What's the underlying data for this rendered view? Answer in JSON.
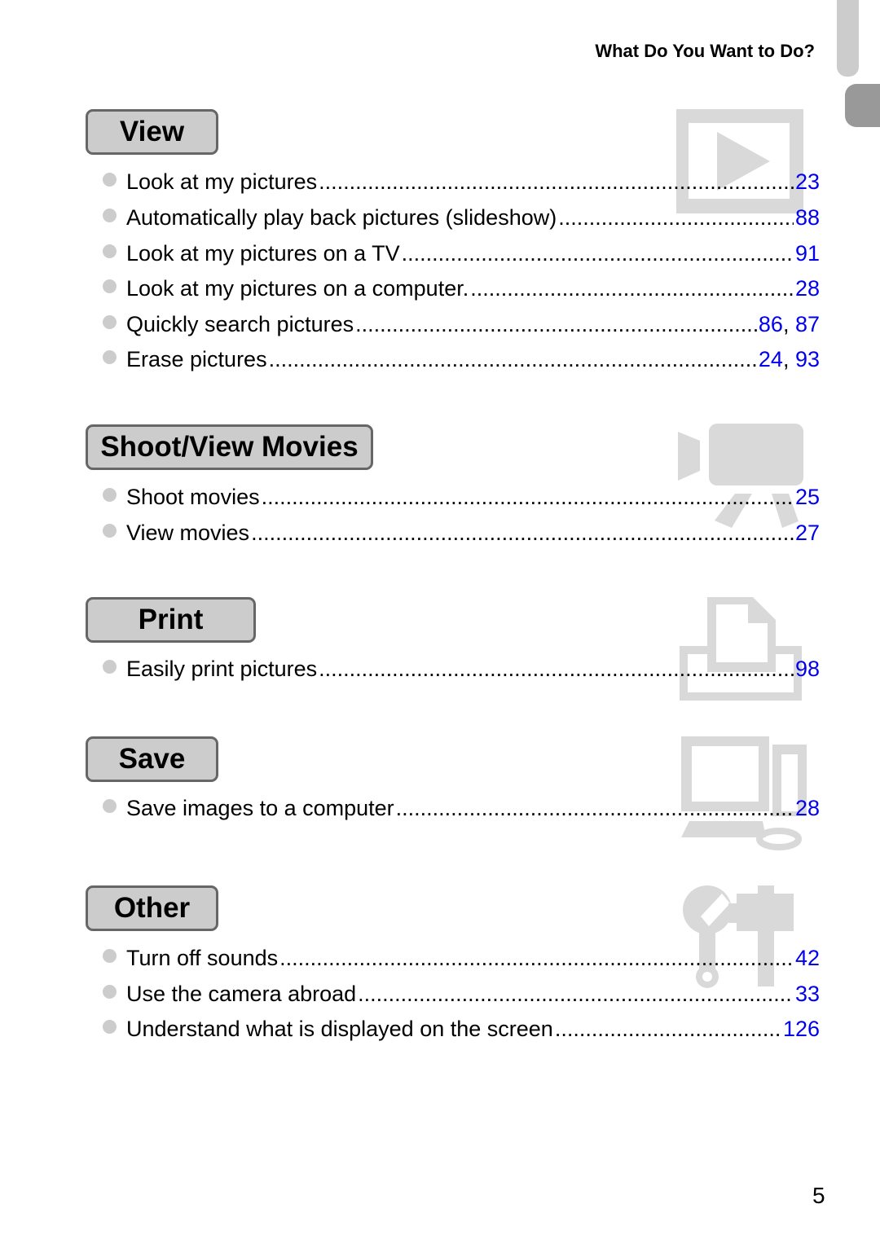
{
  "running_head": "What Do You Want to Do?",
  "page_number": "5",
  "colors": {
    "link": "#0000ee",
    "heading_fill": "#cccccc",
    "heading_border": "#666666",
    "icon_gray": "#d9d9d9"
  },
  "sections": [
    {
      "title": "View",
      "icon": "play-icon",
      "items": [
        {
          "label": "Look at my pictures",
          "pages": [
            "23"
          ]
        },
        {
          "label": "Automatically play back pictures (slideshow)",
          "pages": [
            "88"
          ]
        },
        {
          "label": "Look at my pictures on a TV",
          "pages": [
            "91"
          ]
        },
        {
          "label": "Look at my pictures on a computer.",
          "pages": [
            "28"
          ]
        },
        {
          "label": "Quickly search pictures",
          "pages": [
            "86",
            "87"
          ]
        },
        {
          "label": "Erase pictures",
          "pages": [
            "24",
            "93"
          ]
        }
      ]
    },
    {
      "title": "Shoot/View Movies",
      "icon": "movie-camera-icon",
      "items": [
        {
          "label": "Shoot movies",
          "pages": [
            "25"
          ]
        },
        {
          "label": "View movies",
          "pages": [
            "27"
          ]
        }
      ]
    },
    {
      "title": "Print",
      "icon": "printer-icon",
      "items": [
        {
          "label": "Easily print pictures",
          "pages": [
            "98"
          ]
        }
      ]
    },
    {
      "title": "Save",
      "icon": "computer-icon",
      "items": [
        {
          "label": "Save images to a computer",
          "pages": [
            "28"
          ]
        }
      ]
    },
    {
      "title": "Other",
      "icon": "tools-icon",
      "items": [
        {
          "label": "Turn off sounds",
          "pages": [
            "42"
          ]
        },
        {
          "label": "Use the camera abroad",
          "pages": [
            "33"
          ]
        },
        {
          "label": "Understand what is displayed on the screen",
          "pages": [
            "126"
          ]
        }
      ]
    }
  ]
}
